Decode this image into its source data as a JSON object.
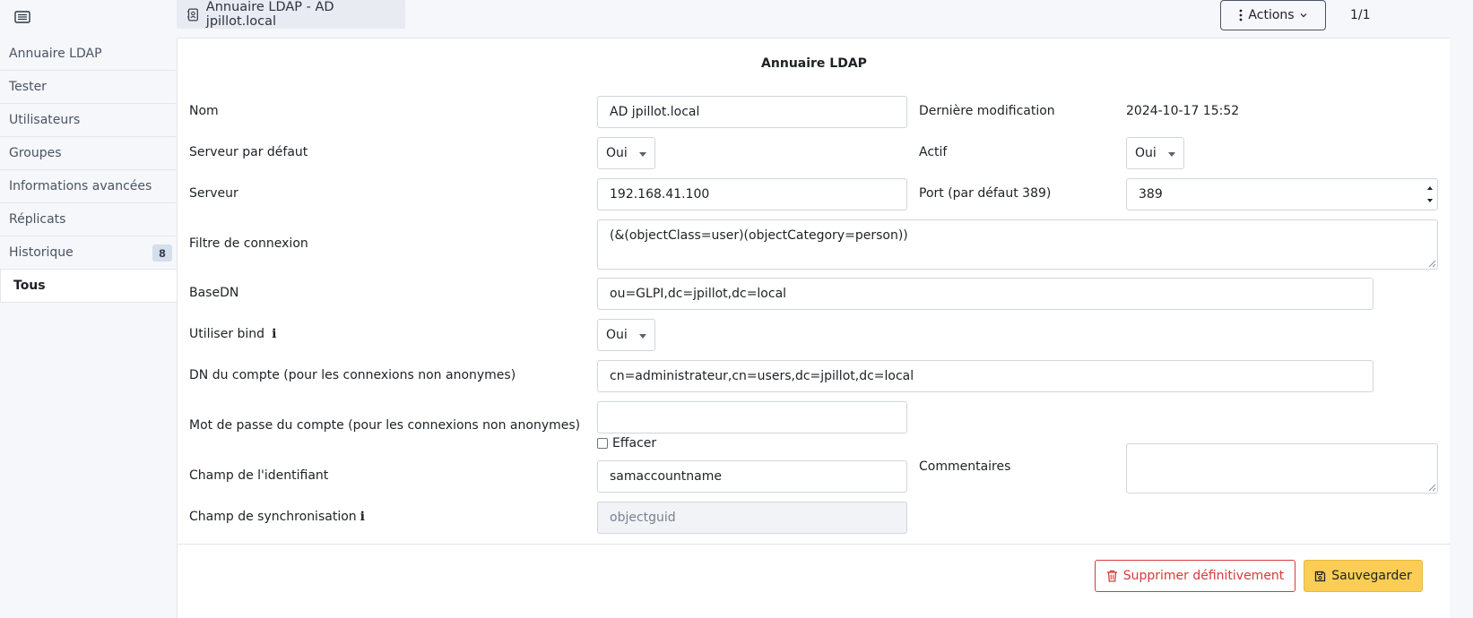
{
  "header": {
    "tab_label": "Annuaire LDAP - AD jpillot.local",
    "actions_label": "Actions",
    "pager": "1/1"
  },
  "sidebar": {
    "items": [
      {
        "label": "Annuaire LDAP"
      },
      {
        "label": "Tester"
      },
      {
        "label": "Utilisateurs"
      },
      {
        "label": "Groupes"
      },
      {
        "label": "Informations avancées"
      },
      {
        "label": "Réplicats"
      },
      {
        "label": "Historique",
        "badge": "8"
      },
      {
        "label": "Tous"
      }
    ]
  },
  "form": {
    "title": "Annuaire LDAP",
    "nom_label": "Nom",
    "nom_value": "AD jpillot.local",
    "last_mod_label": "Dernière modification",
    "last_mod_value": "2024-10-17 15:52",
    "default_server_label": "Serveur par défaut",
    "default_server_value": "Oui",
    "actif_label": "Actif",
    "actif_value": "Oui",
    "server_label": "Serveur",
    "server_value": "192.168.41.100",
    "port_label": "Port (par défaut 389)",
    "port_value": "389",
    "filter_label": "Filtre de connexion",
    "filter_value": "(&(objectClass=user)(objectCategory=person))",
    "basedn_label": "BaseDN",
    "basedn_value": "ou=GLPI,dc=jpillot,dc=local",
    "bind_label": "Utiliser bind",
    "bind_value": "Oui",
    "dn_label": "DN du compte (pour les connexions non anonymes)",
    "dn_value": "cn=administrateur,cn=users,dc=jpillot,dc=local",
    "password_label": "Mot de passe du compte (pour les connexions non anonymes)",
    "password_value": "",
    "erase_label": "Effacer",
    "login_field_label": "Champ de l'identifiant",
    "login_field_value": "samaccountname",
    "comments_label": "Commentaires",
    "sync_field_label": "Champ de synchronisation",
    "sync_field_value": "objectguid"
  },
  "buttons": {
    "delete_label": "Supprimer définitivement",
    "save_label": "Sauvegarder"
  },
  "colors": {
    "accent_save": "#fccd55",
    "danger": "#d63939"
  }
}
